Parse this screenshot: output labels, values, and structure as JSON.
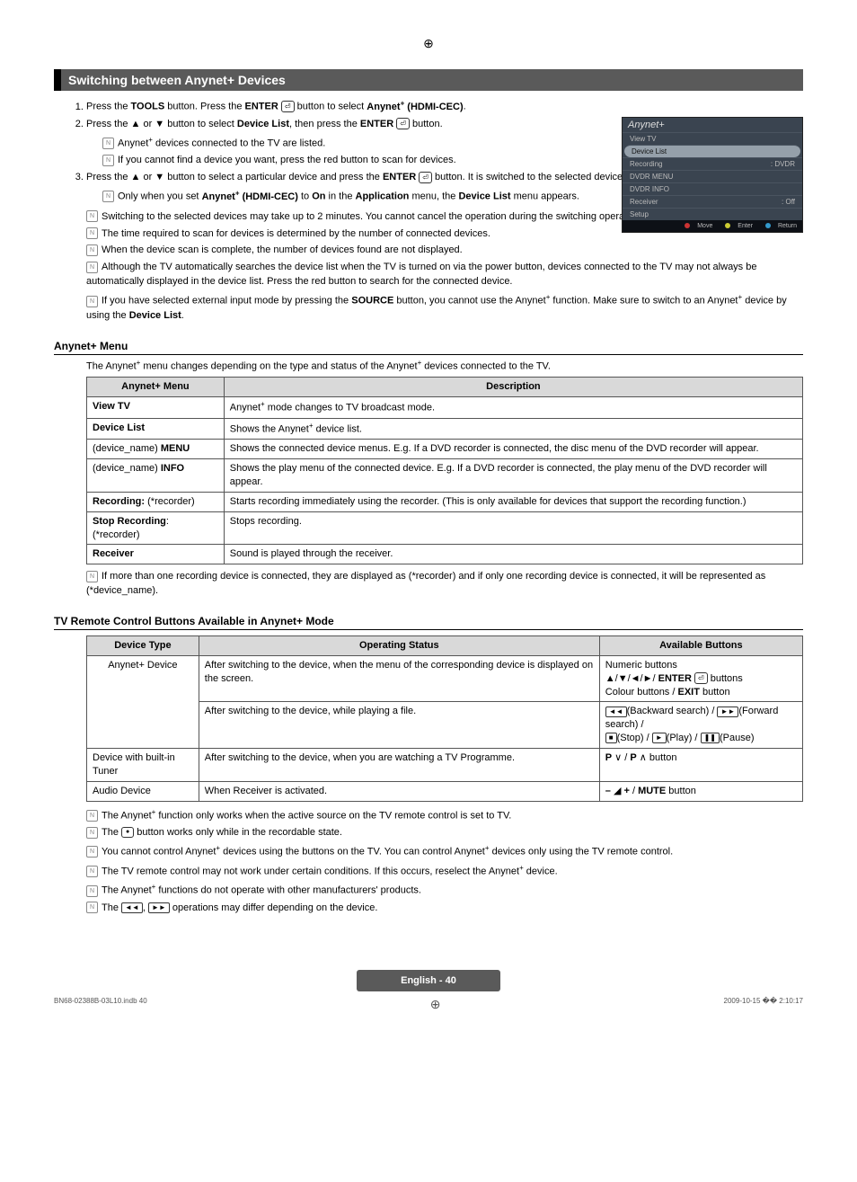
{
  "section_title": "Switching between Anynet+ Devices",
  "steps": {
    "s1a": "Press the ",
    "s1b": "TOOLS",
    "s1c": " button. Press the ",
    "s1d": "ENTER",
    "s1e": " button to select ",
    "s1f": "Anynet",
    "s1g": " (HDMI-CEC)",
    "s1h": ".",
    "s2a": "Press the ▲ or ▼ button to select ",
    "s2b": "Device List",
    "s2c": ", then press the ",
    "s2d": "ENTER",
    "s2e": " button.",
    "s2n1": "Anynet",
    "s2n1b": " devices connected to the TV are listed.",
    "s2n2": "If you cannot find a device you want, press the red button to scan for devices.",
    "s3a": "Press the ▲ or ▼ button to select a particular device and press the ",
    "s3b": "ENTER",
    "s3c": " button. It is switched to the selected device.",
    "s3n1a": "Only when you set ",
    "s3n1b": "Anynet",
    "s3n1c": " (HDMI-CEC)",
    "s3n1d": " to ",
    "s3n1e": "On",
    "s3n1f": " in the ",
    "s3n1g": "Application",
    "s3n1h": " menu, the ",
    "s3n1i": "Device List",
    "s3n1j": " menu appears."
  },
  "notes_a": [
    "Switching to the selected devices may take up to 2 minutes. You cannot cancel the operation during the switching operation.",
    "The time required to scan for devices is determined by the number of connected devices.",
    "When the device scan is complete, the number of devices found are not displayed.",
    "Although the TV automatically searches the device list when the TV is turned on via the power button, devices connected to the TV may not always be automatically displayed in the device list. Press the red button to search for the connected device."
  ],
  "notes_a_last": {
    "a": "If you have selected external input mode by pressing the ",
    "b": "SOURCE",
    "c": " button, you cannot use the Anynet",
    "d": " function. Make sure to switch to an Anynet",
    "e": " device by using the ",
    "f": "Device List",
    "g": "."
  },
  "osd": {
    "title": "Anynet+",
    "rows": [
      {
        "l": "View TV",
        "r": ""
      },
      {
        "l": "Device List",
        "r": "",
        "sel": true
      },
      {
        "l": "Recording",
        "r": ": DVDR"
      },
      {
        "l": "DVDR MENU",
        "r": ""
      },
      {
        "l": "DVDR INFO",
        "r": ""
      },
      {
        "l": "Receiver",
        "r": ": Off"
      },
      {
        "l": "Setup",
        "r": ""
      }
    ],
    "footer": {
      "move": "Move",
      "enter": "Enter",
      "return": "Return"
    }
  },
  "menu_section": {
    "title": "Anynet+ Menu",
    "intro_a": "The Anynet",
    "intro_b": " menu changes depending on the type and status of the Anynet",
    "intro_c": " devices connected to the TV.",
    "headers": {
      "c1": "Anynet+ Menu",
      "c2": "Description"
    },
    "rows": [
      {
        "c1": "View TV",
        "c2": "Anynet+ mode changes to TV broadcast mode.",
        "bold1": true
      },
      {
        "c1": "Device List",
        "c2": "Shows the Anynet+ device list.",
        "bold1": true
      },
      {
        "c1html": "(device_name) <b>MENU</b>",
        "c2": "Shows the connected device menus. E.g. If a DVD recorder is connected, the disc menu of the DVD recorder will appear."
      },
      {
        "c1html": "(device_name) <b>INFO</b>",
        "c2": "Shows the play menu of the connected device. E.g. If a DVD recorder is connected, the play menu of the DVD recorder will appear."
      },
      {
        "c1html": "<b>Recording:</b> (*recorder)",
        "c2": "Starts recording immediately using the recorder. (This is only available for devices that support the recording function.)"
      },
      {
        "c1html": "<b>Stop Recording</b>: (*recorder)",
        "c2": "Stops recording."
      },
      {
        "c1": "Receiver",
        "c2": "Sound is played through the receiver.",
        "bold1": true
      }
    ],
    "after_note": "If more than one recording device is connected, they are displayed as (*recorder) and if only one recording device is connected, it will be represented as (*device_name)."
  },
  "remote_section": {
    "title": "TV Remote Control Buttons Available in Anynet+ Mode",
    "headers": {
      "c1": "Device Type",
      "c2": "Operating Status",
      "c3": "Available Buttons"
    },
    "r1": {
      "type": "Anynet+ Device",
      "op1": "After switching to the device, when the menu of the corresponding device is displayed on the screen.",
      "av1": "Numeric buttons\n▲/▼/◄/►/ ENTER ⏎ buttons\nColour buttons / EXIT button",
      "op2": "After switching to the device, while playing a file.",
      "av2": "◄◄(Backward search) / ►►(Forward search) / ■(Stop) / ►(Play) / ❚❚(Pause)"
    },
    "r2": {
      "type": "Device with built-in Tuner",
      "op": "After switching to the device, when you are watching a TV Programme.",
      "av": "P ∨ / P ∧ button"
    },
    "r3": {
      "type": "Audio Device",
      "op": "When Receiver is activated.",
      "av": "– ◢ + / MUTE button"
    }
  },
  "notes_b": {
    "n1a": "The Anynet",
    "n1b": " function only works when the active source on the TV remote control is set to TV.",
    "n2a": "The ",
    "n2b": " button works only while in the recordable state.",
    "n3a": "You cannot control Anynet",
    "n3b": " devices using the buttons on the TV. You can control Anynet",
    "n3c": " devices only using the TV remote control.",
    "n4a": "The TV remote control may not work under certain conditions. If this occurs, reselect the Anynet",
    "n4b": " device.",
    "n5a": "The Anynet",
    "n5b": " functions do not operate with other manufacturers' products.",
    "n6": "The ◄◄, ►► operations may differ depending on the device."
  },
  "footer": {
    "label": "English - 40"
  },
  "doc_meta": {
    "left": "BN68-02388B-03L10.indb   40",
    "right": "2009-10-15   �� 2:10:17"
  }
}
